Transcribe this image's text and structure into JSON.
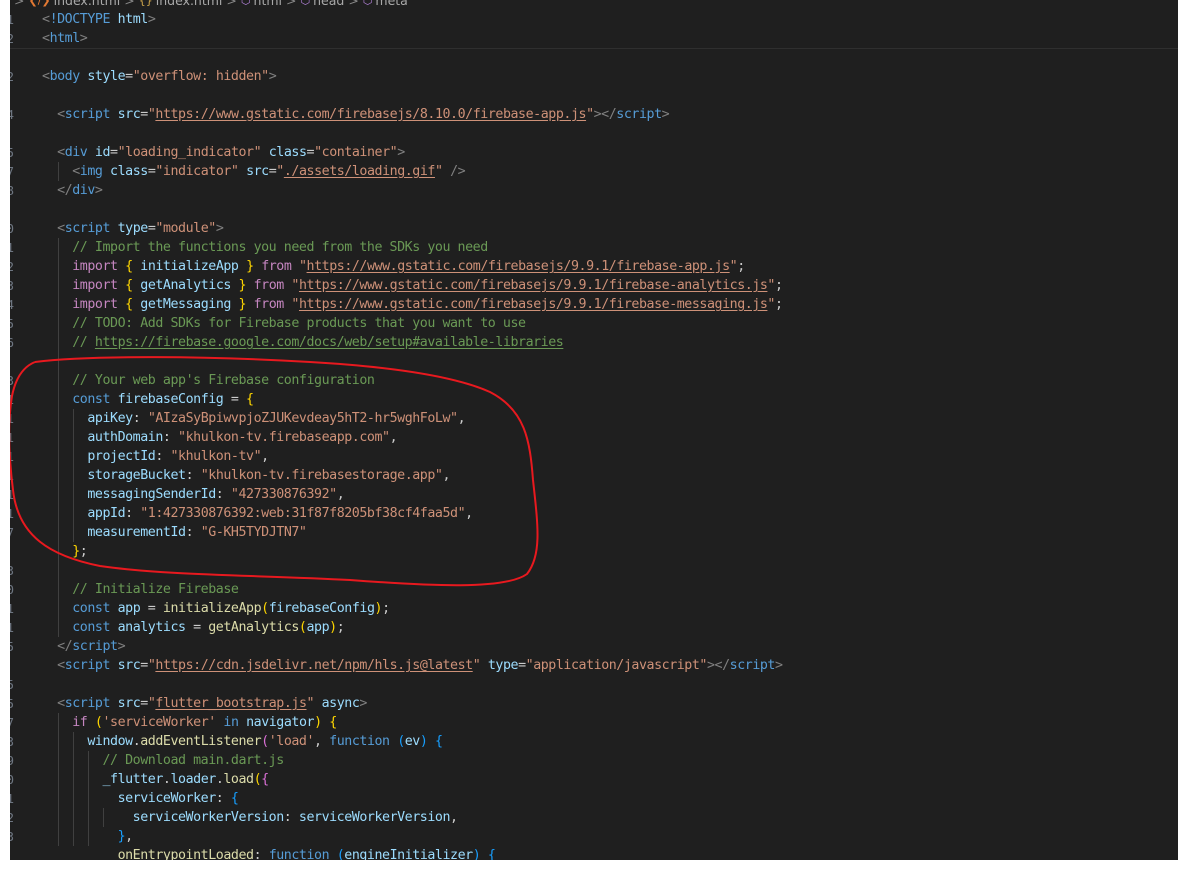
{
  "breadcrumb": [
    {
      "icon": "html-file-icon",
      "label": "index.html"
    },
    {
      "icon": "braces-icon",
      "label": "index.html"
    },
    {
      "icon": "cube-icon",
      "label": "html"
    },
    {
      "icon": "cube-icon",
      "label": "head"
    },
    {
      "icon": "cube-icon",
      "label": "meta"
    }
  ],
  "line_numbers": [
    "1",
    "2",
    "",
    "2",
    "",
    "4",
    "",
    "5",
    "7",
    "8",
    "",
    "0",
    "1",
    "2",
    "3",
    "4",
    "5",
    "6",
    "",
    "3",
    "1",
    "1",
    "1",
    "1",
    "1",
    "1",
    "1",
    "7",
    "",
    "3",
    "0",
    "1",
    "1",
    "5",
    "",
    "5",
    "5",
    "7",
    "3",
    "9",
    "0",
    "1",
    "2",
    "3"
  ],
  "code_lines": [
    [
      [
        "punc",
        "<"
      ],
      [
        "tag",
        "!DOCTYPE"
      ],
      [
        "def",
        " "
      ],
      [
        "attr",
        "html"
      ],
      [
        "punc",
        ">"
      ]
    ],
    [
      [
        "punc",
        "<"
      ],
      [
        "tag",
        "html"
      ],
      [
        "punc",
        ">"
      ]
    ],
    [],
    [
      [
        "punc",
        "<"
      ],
      [
        "tag",
        "body"
      ],
      [
        "def",
        " "
      ],
      [
        "attr",
        "style"
      ],
      [
        "def",
        "="
      ],
      [
        "str",
        "\"overflow: hidden\""
      ],
      [
        "punc",
        ">"
      ]
    ],
    [],
    [
      [
        "def",
        "  "
      ],
      [
        "punc",
        "<"
      ],
      [
        "tag",
        "script"
      ],
      [
        "def",
        " "
      ],
      [
        "attr",
        "src"
      ],
      [
        "def",
        "="
      ],
      [
        "str",
        "\""
      ],
      [
        "url",
        "https://www.gstatic.com/firebasejs/8.10.0/firebase-app.js"
      ],
      [
        "str",
        "\""
      ],
      [
        "punc",
        "></"
      ],
      [
        "tag",
        "script"
      ],
      [
        "punc",
        ">"
      ]
    ],
    [],
    [
      [
        "def",
        "  "
      ],
      [
        "punc",
        "<"
      ],
      [
        "tag",
        "div"
      ],
      [
        "def",
        " "
      ],
      [
        "attr",
        "id"
      ],
      [
        "def",
        "="
      ],
      [
        "str",
        "\"loading_indicator\""
      ],
      [
        "def",
        " "
      ],
      [
        "attr",
        "class"
      ],
      [
        "def",
        "="
      ],
      [
        "str",
        "\"container\""
      ],
      [
        "punc",
        ">"
      ]
    ],
    [
      [
        "def",
        "    "
      ],
      [
        "punc",
        "<"
      ],
      [
        "tag",
        "img"
      ],
      [
        "def",
        " "
      ],
      [
        "attr",
        "class"
      ],
      [
        "def",
        "="
      ],
      [
        "str",
        "\"indicator\""
      ],
      [
        "def",
        " "
      ],
      [
        "attr",
        "src"
      ],
      [
        "def",
        "="
      ],
      [
        "str",
        "\""
      ],
      [
        "url",
        "./assets/loading.gif"
      ],
      [
        "str",
        "\""
      ],
      [
        "def",
        " "
      ],
      [
        "punc",
        "/>"
      ]
    ],
    [
      [
        "def",
        "  "
      ],
      [
        "punc",
        "</"
      ],
      [
        "tag",
        "div"
      ],
      [
        "punc",
        ">"
      ]
    ],
    [],
    [
      [
        "def",
        "  "
      ],
      [
        "punc",
        "<"
      ],
      [
        "tag",
        "script"
      ],
      [
        "def",
        " "
      ],
      [
        "attr",
        "type"
      ],
      [
        "def",
        "="
      ],
      [
        "str",
        "\"module\""
      ],
      [
        "punc",
        ">"
      ]
    ],
    [
      [
        "def",
        "    "
      ],
      [
        "cmt",
        "// Import the functions you need from the SDKs you need"
      ]
    ],
    [
      [
        "def",
        "    "
      ],
      [
        "kw",
        "import"
      ],
      [
        "def",
        " "
      ],
      [
        "brk",
        "{"
      ],
      [
        "def",
        " "
      ],
      [
        "var",
        "initializeApp"
      ],
      [
        "def",
        " "
      ],
      [
        "brk",
        "}"
      ],
      [
        "def",
        " "
      ],
      [
        "kw",
        "from"
      ],
      [
        "def",
        " "
      ],
      [
        "str",
        "\""
      ],
      [
        "url",
        "https://www.gstatic.com/firebasejs/9.9.1/firebase-app.js"
      ],
      [
        "str",
        "\""
      ],
      [
        "def",
        ";"
      ]
    ],
    [
      [
        "def",
        "    "
      ],
      [
        "kw",
        "import"
      ],
      [
        "def",
        " "
      ],
      [
        "brk",
        "{"
      ],
      [
        "def",
        " "
      ],
      [
        "var",
        "getAnalytics"
      ],
      [
        "def",
        " "
      ],
      [
        "brk",
        "}"
      ],
      [
        "def",
        " "
      ],
      [
        "kw",
        "from"
      ],
      [
        "def",
        " "
      ],
      [
        "str",
        "\""
      ],
      [
        "url",
        "https://www.gstatic.com/firebasejs/9.9.1/firebase-analytics.js"
      ],
      [
        "str",
        "\""
      ],
      [
        "def",
        ";"
      ]
    ],
    [
      [
        "def",
        "    "
      ],
      [
        "kw",
        "import"
      ],
      [
        "def",
        " "
      ],
      [
        "brk",
        "{"
      ],
      [
        "def",
        " "
      ],
      [
        "var",
        "getMessaging"
      ],
      [
        "def",
        " "
      ],
      [
        "brk",
        "}"
      ],
      [
        "def",
        " "
      ],
      [
        "kw",
        "from"
      ],
      [
        "def",
        " "
      ],
      [
        "str",
        "\""
      ],
      [
        "url",
        "https://www.gstatic.com/firebasejs/9.9.1/firebase-messaging.js"
      ],
      [
        "str",
        "\""
      ],
      [
        "def",
        ";"
      ]
    ],
    [
      [
        "def",
        "    "
      ],
      [
        "cmt",
        "// TODO: Add SDKs for Firebase products that you want to use"
      ]
    ],
    [
      [
        "def",
        "    "
      ],
      [
        "cmt",
        "// "
      ],
      [
        "cmt-url",
        "https://firebase.google.com/docs/web/setup#available-libraries"
      ]
    ],
    [],
    [
      [
        "def",
        "    "
      ],
      [
        "cmt",
        "// Your web app's Firebase configuration"
      ]
    ],
    [
      [
        "def",
        "    "
      ],
      [
        "kwb",
        "const"
      ],
      [
        "def",
        " "
      ],
      [
        "var",
        "firebaseConfig"
      ],
      [
        "def",
        " = "
      ],
      [
        "brk",
        "{"
      ]
    ],
    [
      [
        "def",
        "      "
      ],
      [
        "var",
        "apiKey"
      ],
      [
        "def",
        ": "
      ],
      [
        "str",
        "\"AIzaSyBpiwvpjoZJUKevdeay5hT2-hr5wghFoLw\""
      ],
      [
        "def",
        ","
      ]
    ],
    [
      [
        "def",
        "      "
      ],
      [
        "var",
        "authDomain"
      ],
      [
        "def",
        ": "
      ],
      [
        "str",
        "\"khulkon-tv.firebaseapp.com\""
      ],
      [
        "def",
        ","
      ]
    ],
    [
      [
        "def",
        "      "
      ],
      [
        "var",
        "projectId"
      ],
      [
        "def",
        ": "
      ],
      [
        "str",
        "\"khulkon-tv\""
      ],
      [
        "def",
        ","
      ]
    ],
    [
      [
        "def",
        "      "
      ],
      [
        "var",
        "storageBucket"
      ],
      [
        "def",
        ": "
      ],
      [
        "str",
        "\"khulkon-tv.firebasestorage.app\""
      ],
      [
        "def",
        ","
      ]
    ],
    [
      [
        "def",
        "      "
      ],
      [
        "var",
        "messagingSenderId"
      ],
      [
        "def",
        ": "
      ],
      [
        "str",
        "\"427330876392\""
      ],
      [
        "def",
        ","
      ]
    ],
    [
      [
        "def",
        "      "
      ],
      [
        "var",
        "appId"
      ],
      [
        "def",
        ": "
      ],
      [
        "str",
        "\"1:427330876392:web:31f87f8205bf38cf4faa5d\""
      ],
      [
        "def",
        ","
      ]
    ],
    [
      [
        "def",
        "      "
      ],
      [
        "var",
        "measurementId"
      ],
      [
        "def",
        ": "
      ],
      [
        "str",
        "\"G-KH5TYDJTN7\""
      ]
    ],
    [
      [
        "def",
        "    "
      ],
      [
        "brk",
        "}"
      ],
      [
        "def",
        ";"
      ]
    ],
    [],
    [
      [
        "def",
        "    "
      ],
      [
        "cmt",
        "// Initialize Firebase"
      ]
    ],
    [
      [
        "def",
        "    "
      ],
      [
        "kwb",
        "const"
      ],
      [
        "def",
        " "
      ],
      [
        "var",
        "app"
      ],
      [
        "def",
        " = "
      ],
      [
        "fn",
        "initializeApp"
      ],
      [
        "brk",
        "("
      ],
      [
        "var",
        "firebaseConfig"
      ],
      [
        "brk",
        ")"
      ],
      [
        "def",
        ";"
      ]
    ],
    [
      [
        "def",
        "    "
      ],
      [
        "kwb",
        "const"
      ],
      [
        "def",
        " "
      ],
      [
        "var",
        "analytics"
      ],
      [
        "def",
        " = "
      ],
      [
        "fn",
        "getAnalytics"
      ],
      [
        "brk",
        "("
      ],
      [
        "var",
        "app"
      ],
      [
        "brk",
        ")"
      ],
      [
        "def",
        ";"
      ]
    ],
    [
      [
        "def",
        "  "
      ],
      [
        "punc",
        "</"
      ],
      [
        "tag",
        "script"
      ],
      [
        "punc",
        ">"
      ]
    ],
    [
      [
        "def",
        "  "
      ],
      [
        "punc",
        "<"
      ],
      [
        "tag",
        "script"
      ],
      [
        "def",
        " "
      ],
      [
        "attr",
        "src"
      ],
      [
        "def",
        "="
      ],
      [
        "str",
        "\""
      ],
      [
        "url",
        "https://cdn.jsdelivr.net/npm/hls.js@latest"
      ],
      [
        "str",
        "\""
      ],
      [
        "def",
        " "
      ],
      [
        "attr",
        "type"
      ],
      [
        "def",
        "="
      ],
      [
        "str",
        "\"application/javascript\""
      ],
      [
        "punc",
        "></"
      ],
      [
        "tag",
        "script"
      ],
      [
        "punc",
        ">"
      ]
    ],
    [],
    [
      [
        "def",
        "  "
      ],
      [
        "punc",
        "<"
      ],
      [
        "tag",
        "script"
      ],
      [
        "def",
        " "
      ],
      [
        "attr",
        "src"
      ],
      [
        "def",
        "="
      ],
      [
        "str",
        "\""
      ],
      [
        "url",
        "flutter_bootstrap.js"
      ],
      [
        "str",
        "\""
      ],
      [
        "def",
        " "
      ],
      [
        "attr",
        "async"
      ],
      [
        "punc",
        ">"
      ]
    ],
    [
      [
        "def",
        "    "
      ],
      [
        "kw",
        "if"
      ],
      [
        "def",
        " "
      ],
      [
        "brk",
        "("
      ],
      [
        "str",
        "'serviceWorker'"
      ],
      [
        "def",
        " "
      ],
      [
        "kwb",
        "in"
      ],
      [
        "def",
        " "
      ],
      [
        "var",
        "navigator"
      ],
      [
        "brk",
        ")"
      ],
      [
        "def",
        " "
      ],
      [
        "brk",
        "{"
      ]
    ],
    [
      [
        "def",
        "      "
      ],
      [
        "var",
        "window"
      ],
      [
        "def",
        "."
      ],
      [
        "fn",
        "addEventListener"
      ],
      [
        "brk2",
        "("
      ],
      [
        "str",
        "'load'"
      ],
      [
        "def",
        ", "
      ],
      [
        "kwb",
        "function"
      ],
      [
        "def",
        " "
      ],
      [
        "brk3",
        "("
      ],
      [
        "var",
        "ev"
      ],
      [
        "brk3",
        ")"
      ],
      [
        "def",
        " "
      ],
      [
        "brk3",
        "{"
      ]
    ],
    [
      [
        "def",
        "        "
      ],
      [
        "cmt",
        "// Download main.dart.js"
      ]
    ],
    [
      [
        "def",
        "        "
      ],
      [
        "var",
        "_flutter"
      ],
      [
        "def",
        "."
      ],
      [
        "var",
        "loader"
      ],
      [
        "def",
        "."
      ],
      [
        "fn",
        "load"
      ],
      [
        "brk",
        "("
      ],
      [
        "brk2",
        "{"
      ]
    ],
    [
      [
        "def",
        "          "
      ],
      [
        "var",
        "serviceWorker"
      ],
      [
        "def",
        ": "
      ],
      [
        "brk3",
        "{"
      ]
    ],
    [
      [
        "def",
        "            "
      ],
      [
        "var",
        "serviceWorkerVersion"
      ],
      [
        "def",
        ": "
      ],
      [
        "var",
        "serviceWorkerVersion"
      ],
      [
        "def",
        ","
      ]
    ],
    [
      [
        "def",
        "          "
      ],
      [
        "brk3",
        "}"
      ],
      [
        "def",
        ","
      ]
    ],
    [
      [
        "def",
        "          "
      ],
      [
        "fn",
        "onEntrypointLoaded"
      ],
      [
        "def",
        ": "
      ],
      [
        "kwb",
        "function"
      ],
      [
        "def",
        " "
      ],
      [
        "brk3",
        "("
      ],
      [
        "var",
        "engineInitializer"
      ],
      [
        "brk3",
        ")"
      ],
      [
        "def",
        " "
      ],
      [
        "brk3",
        "{"
      ]
    ]
  ]
}
